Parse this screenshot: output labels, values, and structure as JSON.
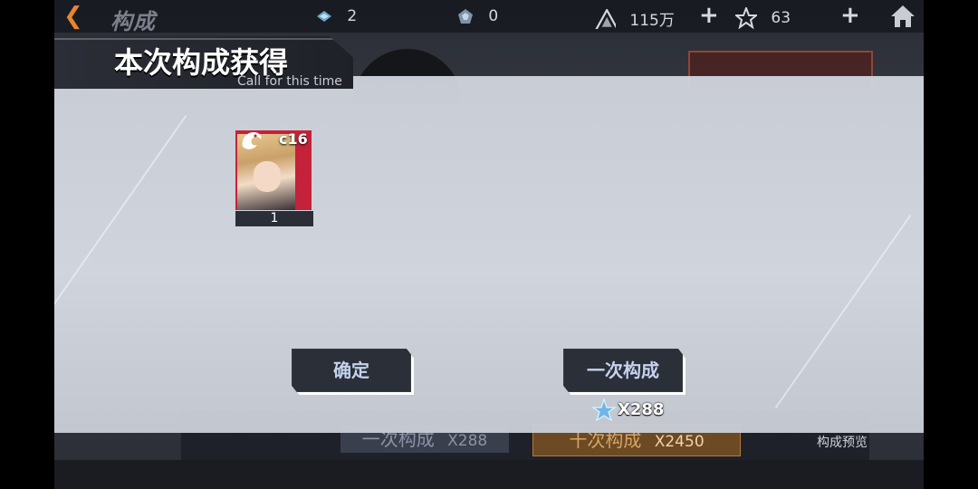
{
  "topbar": {
    "title": "构成",
    "gems": "2",
    "tokens": "0",
    "currency": "115万",
    "stars": "63"
  },
  "background": {
    "pull_once_label": "一次构成",
    "pull_once_cost": "X288",
    "pull_ten_label": "十次构成",
    "pull_ten_cost": "X2450",
    "preview_label": "构成预览"
  },
  "result": {
    "title": "本次构成获得",
    "subtitle": "Call for this time",
    "item": {
      "code": "c16",
      "count": "1"
    },
    "confirm_label": "确定",
    "again_label": "一次构成",
    "again_cost": "X288"
  },
  "colors": {
    "accent": "#e8852f",
    "card_frame": "#c4223a",
    "button_bg": "#2b2f38",
    "button_text": "#c5d3ee",
    "overlay_bg": "#d2d6de"
  },
  "icons": {
    "back": "chevron-left-icon",
    "gems": "gem-stack-icon",
    "tokens": "token-icon",
    "currency": "triangle-currency-icon",
    "stars": "star-icon",
    "home": "home-icon",
    "card_logo": "dragon-emblem-icon",
    "cost": "blue-star-icon"
  }
}
